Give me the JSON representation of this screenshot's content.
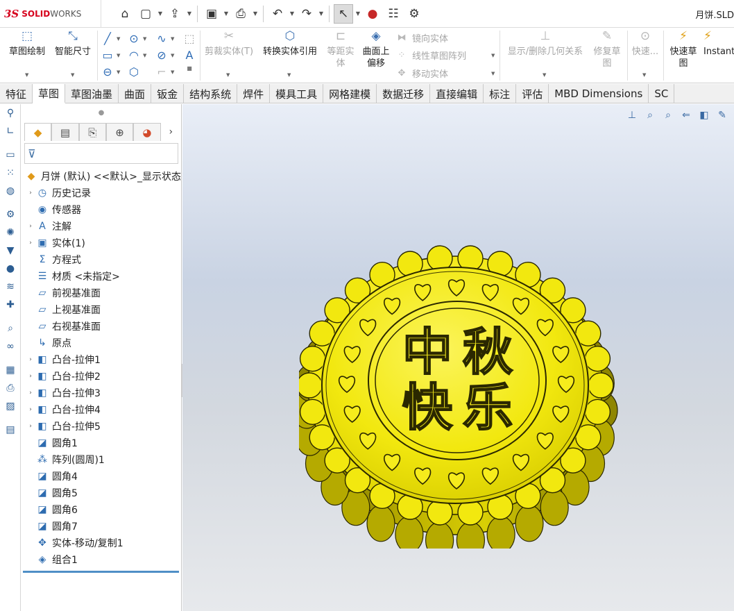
{
  "app": {
    "brand_prefix": "SOLID",
    "brand_suffix": "WORKS",
    "ds_mark": "3S",
    "document_title": "月饼.SLD"
  },
  "quick_access": [
    {
      "icon": "home-icon",
      "glyph": "⌂"
    },
    {
      "icon": "new-document-icon",
      "glyph": "▢"
    },
    {
      "icon": "open-icon",
      "glyph": "⇪"
    },
    {
      "icon": "save-icon",
      "glyph": "▣"
    },
    {
      "icon": "print-icon",
      "glyph": "⎙"
    },
    {
      "icon": "undo-icon",
      "glyph": "↶"
    },
    {
      "icon": "redo-icon",
      "glyph": "↷"
    },
    {
      "icon": "select-pointer-icon",
      "glyph": "↖"
    },
    {
      "icon": "rebuild-traffic-light-icon",
      "glyph": "●"
    },
    {
      "icon": "file-properties-icon",
      "glyph": "☷"
    },
    {
      "icon": "options-gear-icon",
      "glyph": "⚙"
    }
  ],
  "command_manager": {
    "sketch": "草图绘制",
    "smart_dimension": "智能尺寸",
    "trim": "剪裁实体(T)",
    "convert": "转换实体引用",
    "offset_line1": "等距实",
    "offset_line2": "体",
    "surface_offset_line1": "曲面上",
    "surface_offset_line2": "偏移",
    "mirror": "镜向实体",
    "linear_pattern": "线性草图阵列",
    "move": "移动实体",
    "relations": "显示/删除几何关系",
    "repair_line1": "修复草",
    "repair_line2": "图",
    "quick_snaps": "快速...",
    "rapid_sketch_line1": "快速草",
    "rapid_sketch_line2": "图",
    "instant2d": "Instant"
  },
  "tabs": [
    "特征",
    "草图",
    "草图油墨",
    "曲面",
    "钣金",
    "结构系统",
    "焊件",
    "模具工具",
    "网格建模",
    "数据迁移",
    "直接编辑",
    "标注",
    "评估",
    "MBD Dimensions",
    "SC"
  ],
  "active_tab": "草图",
  "feature_tree": {
    "root": "月饼 (默认) <<默认>_显示状态",
    "items": [
      {
        "label": "历史记录",
        "expandable": true,
        "icon": "history-icon",
        "glyph": "◷"
      },
      {
        "label": "传感器",
        "expandable": false,
        "icon": "sensor-icon",
        "glyph": "◉"
      },
      {
        "label": "注解",
        "expandable": true,
        "icon": "annotation-icon",
        "glyph": "A"
      },
      {
        "label": "实体(1)",
        "expandable": true,
        "icon": "solid-bodies-icon",
        "glyph": "▣"
      },
      {
        "label": "方程式",
        "expandable": false,
        "icon": "equations-icon",
        "glyph": "Σ"
      },
      {
        "label": "材质 <未指定>",
        "expandable": false,
        "icon": "material-icon",
        "glyph": "☰"
      },
      {
        "label": "前视基准面",
        "expandable": false,
        "icon": "plane-icon",
        "glyph": "▱"
      },
      {
        "label": "上视基准面",
        "expandable": false,
        "icon": "plane-icon",
        "glyph": "▱"
      },
      {
        "label": "右视基准面",
        "expandable": false,
        "icon": "plane-icon",
        "glyph": "▱"
      },
      {
        "label": "原点",
        "expandable": false,
        "icon": "origin-icon",
        "glyph": "↳"
      },
      {
        "label": "凸台-拉伸1",
        "expandable": true,
        "icon": "boss-extrude-icon",
        "glyph": "◧"
      },
      {
        "label": "凸台-拉伸2",
        "expandable": true,
        "icon": "boss-extrude-icon",
        "glyph": "◧"
      },
      {
        "label": "凸台-拉伸3",
        "expandable": true,
        "icon": "boss-extrude-icon",
        "glyph": "◧"
      },
      {
        "label": "凸台-拉伸4",
        "expandable": true,
        "icon": "boss-extrude-icon",
        "glyph": "◧"
      },
      {
        "label": "凸台-拉伸5",
        "expandable": true,
        "icon": "boss-extrude-icon",
        "glyph": "◧"
      },
      {
        "label": "圆角1",
        "expandable": false,
        "icon": "fillet-icon",
        "glyph": "◪"
      },
      {
        "label": "阵列(圆周)1",
        "expandable": false,
        "icon": "circular-pattern-icon",
        "glyph": "⁂"
      },
      {
        "label": "圆角4",
        "expandable": false,
        "icon": "fillet-icon",
        "glyph": "◪"
      },
      {
        "label": "圆角5",
        "expandable": false,
        "icon": "fillet-icon",
        "glyph": "◪"
      },
      {
        "label": "圆角6",
        "expandable": false,
        "icon": "fillet-icon",
        "glyph": "◪"
      },
      {
        "label": "圆角7",
        "expandable": false,
        "icon": "fillet-icon",
        "glyph": "◪"
      },
      {
        "label": "实体-移动/复制1",
        "expandable": false,
        "icon": "move-copy-icon",
        "glyph": "✥"
      },
      {
        "label": "组合1",
        "expandable": false,
        "icon": "combine-icon",
        "glyph": "◈"
      }
    ]
  },
  "model": {
    "text_top_left": "中",
    "text_top_right": "秋",
    "text_bottom_left": "快",
    "text_bottom_right": "乐",
    "color": "#f2e80f",
    "shade": "#8f8600"
  }
}
